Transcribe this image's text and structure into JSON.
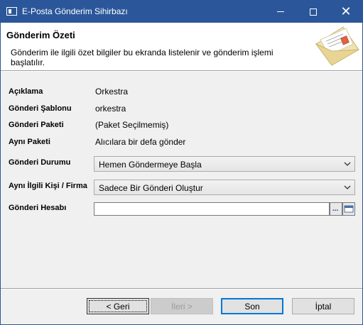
{
  "window": {
    "title": "E-Posta Gönderim Sihirbazı"
  },
  "header": {
    "title": "Gönderim Özeti",
    "description": "Gönderim ile ilgili özet bilgiler bu ekranda listelenir ve gönderim işlemi başlatılır."
  },
  "form": {
    "aciklama": {
      "label": "Açıklama",
      "value": "Orkestra"
    },
    "sablon": {
      "label": "Gönderi Şablonu",
      "value": "orkestra"
    },
    "paket": {
      "label": "Gönderi Paketi",
      "value": "(Paket Seçilmemiş)"
    },
    "ayni_paket": {
      "label": "Aynı Paketi",
      "value": "Alıcılara bir defa gönder"
    },
    "durum": {
      "label": "Gönderi Durumu",
      "selected": "Hemen Göndermeye Başla"
    },
    "kisi_firma": {
      "label": "Aynı İlgili Kişi / Firma",
      "selected": "Sadece Bir Gönderi Oluştur"
    },
    "hesap": {
      "label": "Gönderi Hesabı",
      "value": "",
      "browse_label": "..."
    }
  },
  "buttons": {
    "back": "< Geri",
    "next": "İleri >",
    "finish": "Son",
    "cancel": "İptal"
  },
  "colors": {
    "titlebar": "#2b579a",
    "finish_border": "#0078d7"
  },
  "icons": [
    "app-icon",
    "minimize-icon",
    "maximize-icon",
    "close-icon",
    "envelope-icon",
    "chevron-down-icon",
    "browse-icon",
    "open-folder-icon"
  ]
}
